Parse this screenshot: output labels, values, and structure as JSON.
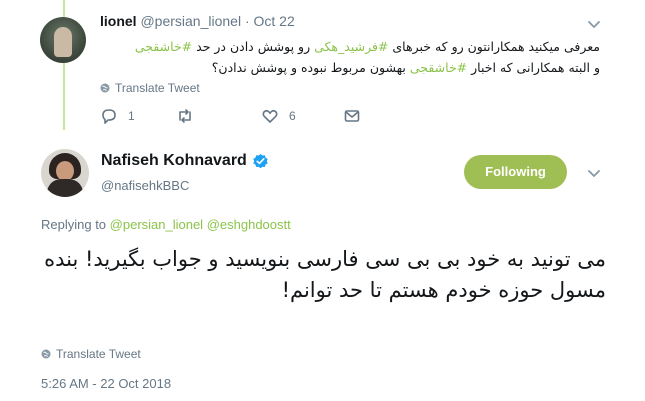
{
  "reply_tweet": {
    "author_name": "lionel",
    "handle": "@persian_lionel",
    "separator": "·",
    "date": "Oct 22",
    "text_line1_a": "معرفی میکنید همکارانتون رو که خبرهای ",
    "hashtag1": "#فرشید_هکی",
    "text_line1_b": " رو پوشش دادن در حد ",
    "hashtag2": "#خاشقجی",
    "text_line2_a": "و البته همکارانی که اخبار ",
    "hashtag3": "#خاشقجی",
    "text_line2_b": " بهشون مربوط نبوده و پوشش ندادن؟",
    "translate_label": "Translate Tweet",
    "reply_count": "1",
    "retweet_count": "",
    "like_count": "6"
  },
  "main_tweet": {
    "author_name": "Nafiseh Kohnavard",
    "handle": "@nafisehkBBC",
    "follow_label": "Following",
    "replying_prefix": "Replying to ",
    "mention1": "@persian_lionel",
    "mention2": "@eshghdoostt",
    "text": "می تونید به خود بی بی سی فارسی بنویسید و جواب بگیرید! بنده مسول حوزه خودم هستم تا حد توانم!",
    "translate_label": "Translate Tweet",
    "timestamp": "5:26 AM - 22 Oct 2018"
  },
  "colors": {
    "accent": "#8bc34a",
    "follow_button": "#9fbf55",
    "verified": "#1da1f2",
    "muted": "#657786"
  },
  "icons": [
    "chevron-down-icon",
    "globe-icon",
    "reply-icon",
    "retweet-icon",
    "like-icon",
    "dm-icon",
    "verified-icon"
  ]
}
